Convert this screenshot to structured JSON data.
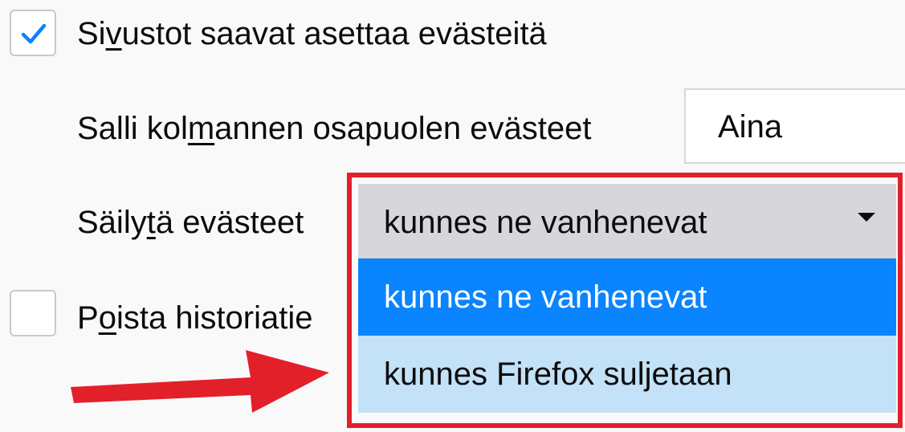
{
  "settings": {
    "accept_cookies": {
      "label_pre": "Si",
      "label_mnemonic": "v",
      "label_post": "ustot saavat asettaa evästeitä",
      "checked": true
    },
    "third_party": {
      "label_pre": "Salli kol",
      "label_mnemonic": "m",
      "label_post": "annen osapuolen evästeet",
      "selected_value": "Aina"
    },
    "keep_until": {
      "label_pre": "Säily",
      "label_mnemonic": "t",
      "label_post": "ä evästeet",
      "selected_value": "kunnes ne vanhenevat",
      "options": [
        {
          "label": "kunnes ne vanhenevat",
          "state": "selected"
        },
        {
          "label": "kunnes Firefox suljetaan",
          "state": "hover"
        }
      ]
    },
    "clear_history": {
      "label_pre": "P",
      "label_mnemonic": "o",
      "label_post": "ista historiatie",
      "checked": false
    }
  },
  "colors": {
    "accent": "#0a84ff",
    "hover": "#c3e1f7",
    "annotation": "#e2202a",
    "checkmark": "#0a84ff"
  },
  "icons": {
    "checkmark": "checkmark-icon",
    "dropdown_caret": "dropdown-caret-icon",
    "annotation_arrow": "arrow-right-icon"
  }
}
